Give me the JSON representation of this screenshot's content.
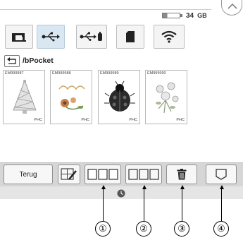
{
  "status": {
    "storage_value": "34",
    "storage_unit": "GB"
  },
  "source_tabs": [
    {
      "icon": "sewing-machine-icon",
      "active": false
    },
    {
      "icon": "usb-icon",
      "active": true
    },
    {
      "icon": "usb-device-icon",
      "active": false
    },
    {
      "icon": "sd-card-icon",
      "active": false
    },
    {
      "icon": "wifi-icon",
      "active": false
    }
  ],
  "path": {
    "text": "/bPocket"
  },
  "patterns": [
    {
      "code": "EM999987",
      "tag": "PHC",
      "icon": "christmas-tree-icon"
    },
    {
      "code": "EM999988",
      "tag": "PHC",
      "icon": "season-flowers-icon"
    },
    {
      "code": "EM999989",
      "tag": "PHC",
      "icon": "ladybug-icon"
    },
    {
      "code": "EM999990",
      "tag": "PHC",
      "icon": "flower-bouquet-icon"
    }
  ],
  "toolbar": {
    "back_label": "Terug"
  },
  "callouts": [
    "①",
    "②",
    "③",
    "④"
  ],
  "colors": {
    "active_tab": "#d9e7f3",
    "bar": "#d6d6d6"
  }
}
